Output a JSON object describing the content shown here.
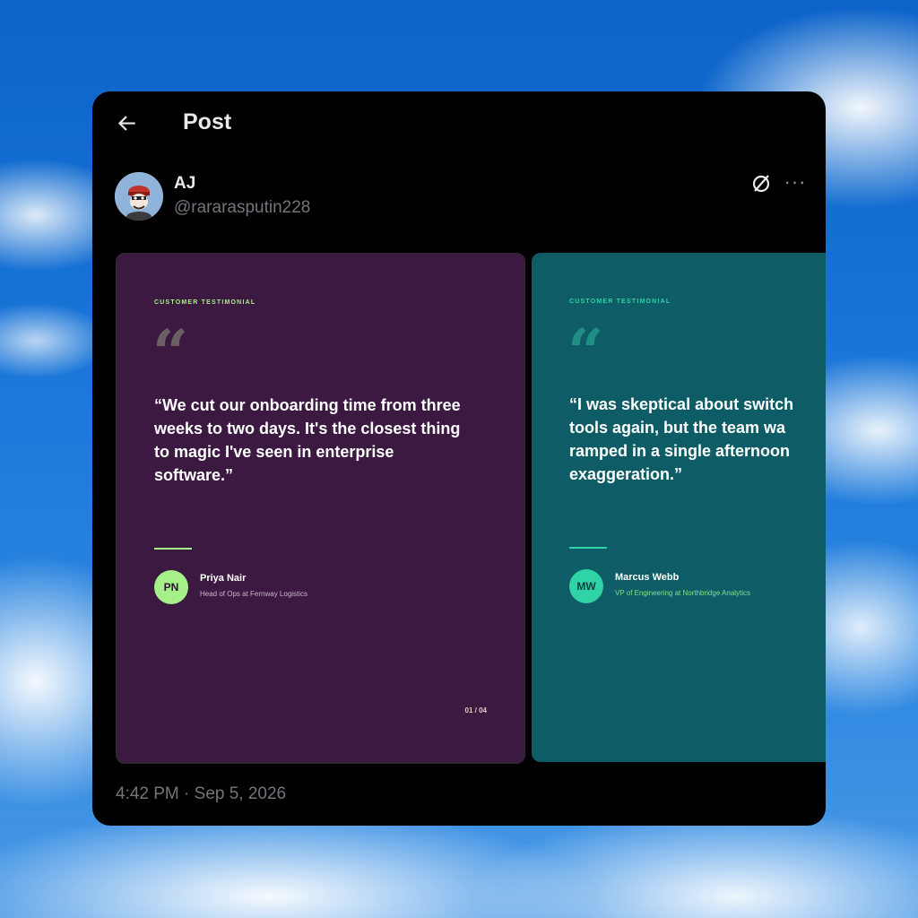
{
  "header": {
    "title": "Post",
    "back_icon": "arrow-left-icon"
  },
  "author": {
    "name": "AJ",
    "handle": "@rararasputin228",
    "avatar_icon": "avatar-icon"
  },
  "actions": {
    "grok_icon": "grok-icon",
    "more_label": "···"
  },
  "slides": [
    {
      "eyebrow": "CUSTOMER TESTIMONIAL",
      "quote_mark": "“",
      "quote": "“We cut our onboarding time from three weeks to two days. It's the closest thing to magic I've seen in enterprise software.”",
      "initials": "PN",
      "person_name": "Priya Nair",
      "person_role": "Head of Ops at Fernway Logistics",
      "counter": "01 / 04",
      "colors": {
        "background": "#3b1941",
        "accent": "#a6f08a",
        "eyebrow": "#a6f08a",
        "quote_mark": "#6b5f64"
      }
    },
    {
      "eyebrow": "CUSTOMER TESTIMONIAL",
      "quote_mark": "“",
      "quote": "“I was skeptical about switch\ntools again, but the team wa\nramped in a single afternoon\nexaggeration.”",
      "initials": "MW",
      "person_name": "Marcus Webb",
      "person_role": "VP of Engineering at Northbridge Analytics",
      "colors": {
        "background": "#0e5d66",
        "accent": "#2fd3a5",
        "eyebrow": "#2fd3a5",
        "quote_mark": "#1f8f86"
      }
    }
  ],
  "timestamp": "4:42 PM · Sep 5, 2026"
}
